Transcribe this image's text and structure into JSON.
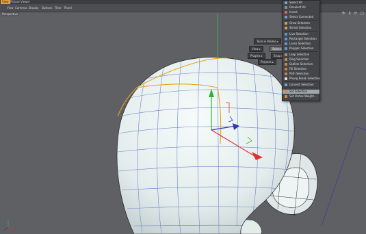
{
  "tabs": [
    "View",
    "Picture Viewer"
  ],
  "menubar": [
    "View",
    "Cameras",
    "Display",
    "Options",
    "Filter",
    "Panel"
  ],
  "view_label": "Perspective",
  "viewport_icons": "✣ ⇕ ⟳ ▢",
  "hud": {
    "tools_modes": "Tools & Modes ▸",
    "view": "View ▸",
    "select": "Select ▸",
    "plugins": "Plugins ▸",
    "snap": "Snap ▸",
    "projects": "Projects ▸"
  },
  "select_menu": {
    "items": [
      {
        "label": "Select All",
        "icon": "select-all-icon"
      },
      {
        "label": "Deselect All",
        "icon": "deselect-all-icon"
      },
      {
        "label": "Invert",
        "icon": "invert-icon"
      },
      {
        "label": "Select Connected",
        "icon": "select-connected-icon"
      },
      {
        "label": "Grow Selection",
        "icon": "grow-selection-icon"
      },
      {
        "label": "Shrink Selection",
        "icon": "shrink-selection-icon"
      },
      {
        "label": "Live Selection",
        "icon": "live-selection-icon"
      },
      {
        "label": "Rectangle Selection",
        "icon": "rectangle-selection-icon"
      },
      {
        "label": "Lasso Selection",
        "icon": "lasso-selection-icon"
      },
      {
        "label": "Polygon Selection",
        "icon": "polygon-selection-icon"
      },
      {
        "label": "Loop Selection",
        "icon": "loop-selection-icon"
      },
      {
        "label": "Ring Selection",
        "icon": "ring-selection-icon"
      },
      {
        "label": "Outline Selection",
        "icon": "outline-selection-icon"
      },
      {
        "label": "Fill Selection",
        "icon": "fill-selection-icon"
      },
      {
        "label": "Path Selection",
        "icon": "path-selection-icon"
      },
      {
        "label": "Phong Break Selection",
        "icon": "phong-break-selection-icon"
      },
      {
        "label": "Convert Selection",
        "icon": "convert-selection-icon"
      },
      {
        "label": "Set Selection",
        "icon": "set-selection-icon"
      },
      {
        "label": "Set Vertex Weight...",
        "icon": "set-vertex-weight-icon"
      }
    ],
    "highlighted": "Set Selection"
  },
  "colors": {
    "viewport_bg": "#5f6063",
    "mesh_fill": "#e6eeee",
    "wire": "#6f86c6",
    "selected_edge": "#e8a21a",
    "axis_x": "#e03030",
    "axis_y": "#2fb52f",
    "axis_z": "#3436b0",
    "menu_bg": "#444548",
    "menu_highlight": "#9fa6ad",
    "active_tab": "#e2a23c"
  }
}
